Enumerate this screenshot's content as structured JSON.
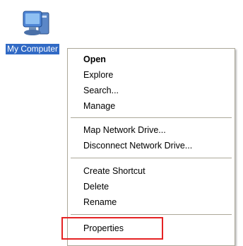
{
  "desktop": {
    "icon": {
      "label": "My Computer",
      "icon_name": "my-computer-icon"
    }
  },
  "context_menu": {
    "items": [
      {
        "label": "Open",
        "bold": true
      },
      {
        "label": "Explore"
      },
      {
        "label": "Search..."
      },
      {
        "label": "Manage"
      },
      {
        "label": "Map Network Drive..."
      },
      {
        "label": "Disconnect Network Drive..."
      },
      {
        "label": "Create Shortcut"
      },
      {
        "label": "Delete"
      },
      {
        "label": "Rename"
      },
      {
        "label": "Properties"
      }
    ]
  },
  "colors": {
    "selection": "#316ac5",
    "highlight_box": "#e52324",
    "menu_border": "#aca899"
  }
}
